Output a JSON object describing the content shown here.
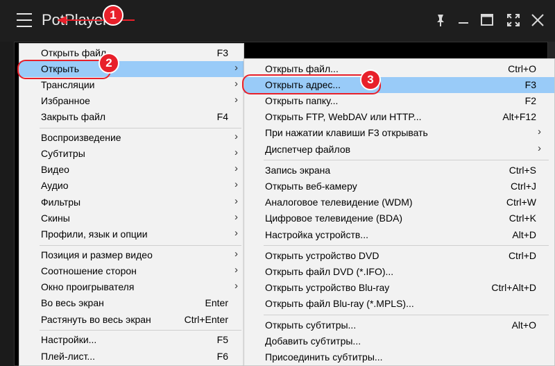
{
  "app": {
    "title": "PotPlayer"
  },
  "window_controls": [
    "pin-icon",
    "maximize-icon",
    "fullscreen-icon",
    "close-icon"
  ],
  "accent_color": "#e8202a",
  "highlight_color": "#99cbf8",
  "main_menu": [
    {
      "label": "Открыть файл...",
      "shortcut": "F3",
      "submenu": false
    },
    {
      "label": "Открыть",
      "shortcut": "",
      "submenu": true,
      "highlighted": true
    },
    {
      "label": "Трансляции",
      "shortcut": "",
      "submenu": true
    },
    {
      "label": "Избранное",
      "shortcut": "",
      "submenu": true
    },
    {
      "label": "Закрыть файл",
      "shortcut": "F4",
      "submenu": false
    },
    {
      "label": "Воспроизведение",
      "shortcut": "",
      "submenu": true
    },
    {
      "label": "Субтитры",
      "shortcut": "",
      "submenu": true
    },
    {
      "label": "Видео",
      "shortcut": "",
      "submenu": true
    },
    {
      "label": "Аудио",
      "shortcut": "",
      "submenu": true
    },
    {
      "label": "Фильтры",
      "shortcut": "",
      "submenu": true
    },
    {
      "label": "Скины",
      "shortcut": "",
      "submenu": true
    },
    {
      "label": "Профили, язык и опции",
      "shortcut": "",
      "submenu": true
    },
    {
      "label": "Позиция и размер видео",
      "shortcut": "",
      "submenu": true
    },
    {
      "label": "Соотношение сторон",
      "shortcut": "",
      "submenu": true
    },
    {
      "label": "Окно проигрывателя",
      "shortcut": "",
      "submenu": true
    },
    {
      "label": "Во весь экран",
      "shortcut": "Enter",
      "submenu": false
    },
    {
      "label": "Растянуть во весь экран",
      "shortcut": "Ctrl+Enter",
      "submenu": false
    },
    {
      "label": "Настройки...",
      "shortcut": "F5",
      "submenu": false
    },
    {
      "label": "Плей-лист...",
      "shortcut": "F6",
      "submenu": false
    }
  ],
  "open_submenu": [
    {
      "label": "Открыть файл...",
      "shortcut": "Ctrl+O",
      "submenu": false
    },
    {
      "label": "Открыть адрес...",
      "shortcut": "F3",
      "submenu": false,
      "highlighted": true
    },
    {
      "label": "Открыть папку...",
      "shortcut": "F2",
      "submenu": false
    },
    {
      "label": "Открыть FTP, WebDAV или HTTP...",
      "shortcut": "Alt+F12",
      "submenu": false
    },
    {
      "label": "При нажатии клавиши F3 открывать",
      "shortcut": "",
      "submenu": true
    },
    {
      "label": "Диспетчер файлов",
      "shortcut": "",
      "submenu": true
    },
    {
      "label": "Запись экрана",
      "shortcut": "Ctrl+S",
      "submenu": false
    },
    {
      "label": "Открыть веб-камеру",
      "shortcut": "Ctrl+J",
      "submenu": false
    },
    {
      "label": "Аналоговое телевидение (WDM)",
      "shortcut": "Ctrl+W",
      "submenu": false
    },
    {
      "label": "Цифровое телевидение (BDA)",
      "shortcut": "Ctrl+K",
      "submenu": false
    },
    {
      "label": "Настройка устройств...",
      "shortcut": "Alt+D",
      "submenu": false
    },
    {
      "label": "Открыть устройство DVD",
      "shortcut": "Ctrl+D",
      "submenu": false
    },
    {
      "label": "Открыть файл DVD (*.IFO)...",
      "shortcut": "",
      "submenu": false
    },
    {
      "label": "Открыть устройство Blu-ray",
      "shortcut": "Ctrl+Alt+D",
      "submenu": false
    },
    {
      "label": "Открыть файл Blu-ray (*.MPLS)...",
      "shortcut": "",
      "submenu": false
    },
    {
      "label": "Открыть субтитры...",
      "shortcut": "Alt+O",
      "submenu": false
    },
    {
      "label": "Добавить субтитры...",
      "shortcut": "",
      "submenu": false
    },
    {
      "label": "Присоединить субтитры...",
      "shortcut": "",
      "submenu": false
    }
  ],
  "annotations": [
    "1",
    "2",
    "3"
  ]
}
